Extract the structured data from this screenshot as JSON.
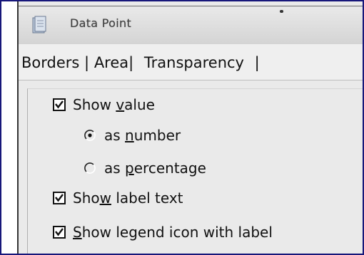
{
  "window": {
    "title": "Data Point",
    "icon": "document-icon"
  },
  "tabs": [
    {
      "label": "Borders"
    },
    {
      "label": "Area"
    },
    {
      "label": "Transparency"
    }
  ],
  "separator": "|",
  "options": {
    "show_value": {
      "pre": "Show ",
      "ul": "v",
      "post": "alue",
      "checked": true
    },
    "as_number": {
      "pre": "as ",
      "ul": "n",
      "post": "umber",
      "selected": true
    },
    "as_percentage": {
      "pre": "as ",
      "ul": "p",
      "post": "ercentage",
      "selected": false
    },
    "show_label_text": {
      "pre": "Sho",
      "ul": "w",
      "post": " label text",
      "checked": true
    },
    "show_legend_icon": {
      "pre": "",
      "ul": "S",
      "post": "how legend icon with label",
      "checked": true
    }
  },
  "colors": {
    "border": "#17177a",
    "titlebar": "#dcdcdc",
    "panel": "#eaeaea"
  }
}
